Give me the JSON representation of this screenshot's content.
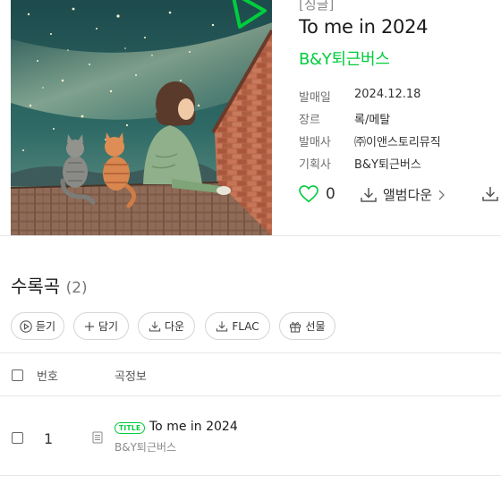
{
  "album": {
    "type": "[싱글]",
    "title": "To me in 2024",
    "artist": "B&Y퇴근버스",
    "cover_icon": "album-cover-night-sky-girl-cats-illustration",
    "meta": [
      {
        "key": "발매일",
        "value": "2024.12.18"
      },
      {
        "key": "장르",
        "value": "록/메탈"
      },
      {
        "key": "발매사",
        "value": "㈜이앤스토리뮤직"
      },
      {
        "key": "기획사",
        "value": "B&Y퇴근버스"
      }
    ],
    "like_count": "0",
    "download_label": "앨범다운"
  },
  "tracklist": {
    "title": "수록곡",
    "count": "(2)",
    "buttons": {
      "play": "듣기",
      "add": "담기",
      "download": "다운",
      "flac": "FLAC",
      "gift": "선물"
    },
    "headers": {
      "number": "번호",
      "song_info": "곡정보"
    },
    "rows": [
      {
        "number": "1",
        "badge": "TITLE",
        "title": "To me in 2024",
        "artist": "B&Y퇴근버스"
      }
    ]
  },
  "colors": {
    "accent": "#00cd3c",
    "text": "#1a1a1a",
    "muted": "#8a8a8a",
    "border": "#d5d5d5"
  }
}
